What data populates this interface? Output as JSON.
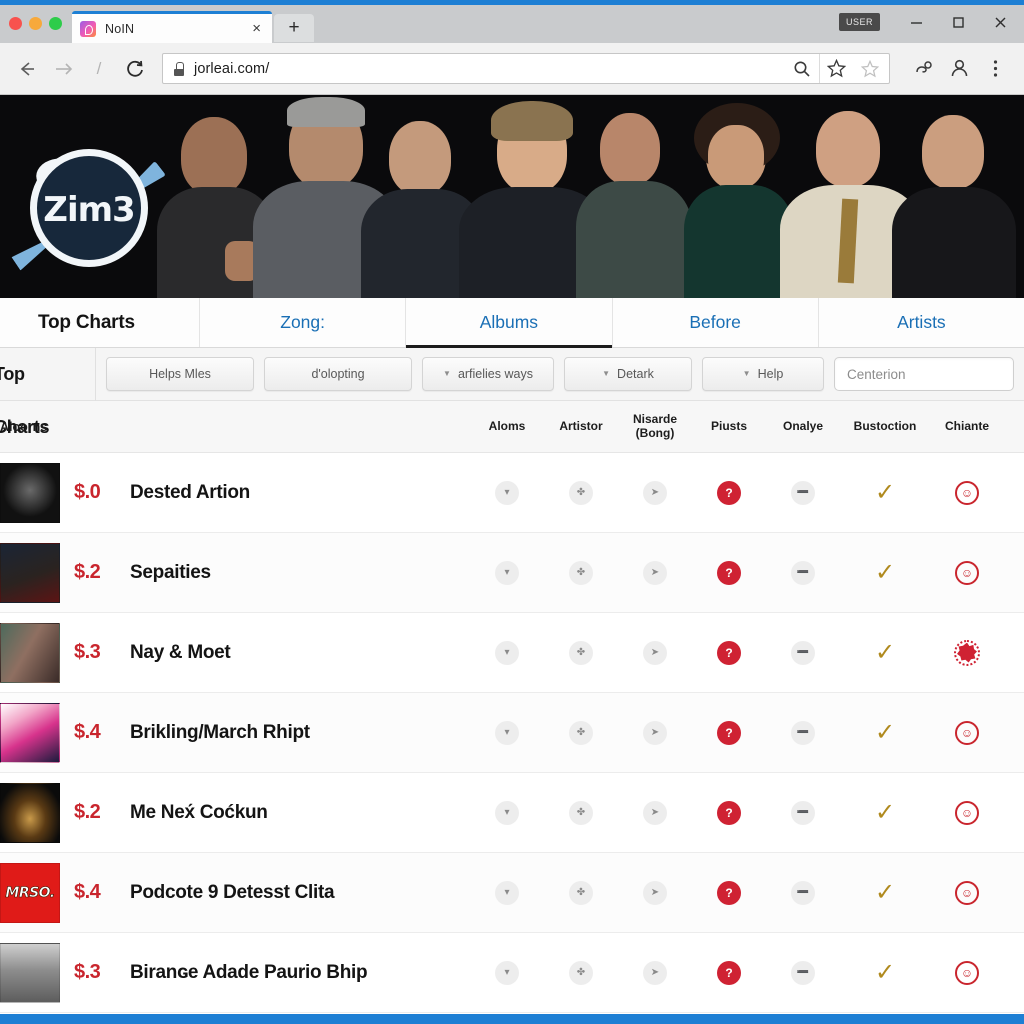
{
  "browser": {
    "tab": {
      "title": "NoIN",
      "close_label": "×",
      "favicon": "app-favicon"
    },
    "newtab_label": "+",
    "window_badge": "USER",
    "minimize_label": "—",
    "maximize_label": "□",
    "close_label": "✕",
    "back_label": "←",
    "forward_label": "→",
    "divider_label": "/",
    "reload_label": "⟳",
    "url": "jorleai.com/",
    "search_icon": "search-icon",
    "bookmark_icon": "star-icon",
    "bookmark_alt_icon": "star-outline-icon",
    "extensions_icon": "extensions-icon",
    "profile_icon": "profile-icon",
    "menu_icon": "kebab-menu-icon"
  },
  "hero": {
    "logo_text": "Zim3",
    "alt": "band-photo-banner"
  },
  "sitenav": {
    "brand": "Top Charts",
    "items": [
      {
        "label": "Zong:",
        "active": false
      },
      {
        "label": "Albums",
        "active": true
      },
      {
        "label": "Before",
        "active": false
      },
      {
        "label": "Artists",
        "active": false
      }
    ]
  },
  "filterbar": {
    "title": "Top Charts",
    "chips": [
      {
        "label": "Helps Mles",
        "caret": false,
        "width": "w1"
      },
      {
        "label": "d'olopting",
        "caret": false,
        "width": "w1"
      },
      {
        "label": "arfielies ways",
        "caret": true,
        "width": "w2"
      },
      {
        "label": "Detark",
        "caret": true,
        "width": "w3"
      },
      {
        "label": "Help",
        "caret": true,
        "width": "w4"
      }
    ],
    "search": {
      "placeholder": "Centerion",
      "value": "",
      "icon": "search-icon"
    }
  },
  "table": {
    "columns": [
      "Aloorns",
      "Aloms",
      "Artistor",
      "Nisarde (Bong)",
      "Piusts",
      "Onalye",
      "Bustoction",
      "Chiante"
    ],
    "col_nisarde_line1": "Nisarde",
    "col_nisarde_line2": "(Bong)",
    "rows": [
      {
        "price": "$.0",
        "title": "Dested Artion",
        "thumb": "dark-album-art",
        "last_icon": "smiley"
      },
      {
        "price": "$.2",
        "title": "Sepaities",
        "thumb": "hat-portrait-art",
        "last_icon": "smiley"
      },
      {
        "price": "$.3",
        "title": "Nay & Moet",
        "thumb": "woman-portrait-art",
        "last_icon": "burst"
      },
      {
        "price": "$.4",
        "title": "Brikling/March Rhipt",
        "thumb": "pink-collage-art",
        "last_icon": "smiley"
      },
      {
        "price": "$.2",
        "title": "Me Nex́ Coćkun",
        "thumb": "stage-lights-art",
        "last_icon": "smiley"
      },
      {
        "price": "$.4",
        "title": "Podcote 9 Detesst Clita",
        "thumb": "mrso-red-logo-art",
        "last_icon": "smiley"
      },
      {
        "price": "$.3",
        "title": "Biranɢe Adade Paurio Bhip",
        "thumb": "man-grey-portrait-art",
        "last_icon": "smiley"
      }
    ],
    "row_icons": [
      "▾",
      "✤",
      "➤",
      "❙",
      "➖"
    ],
    "red_icon_label": "?",
    "check_label": "✓",
    "smiley_label": "☺"
  },
  "colors": {
    "accent_blue": "#1d7fd4",
    "link_blue": "#1a6fb5",
    "price_red": "#c9252d",
    "check_gold": "#b08a1e",
    "badge_red": "#cf2233"
  }
}
